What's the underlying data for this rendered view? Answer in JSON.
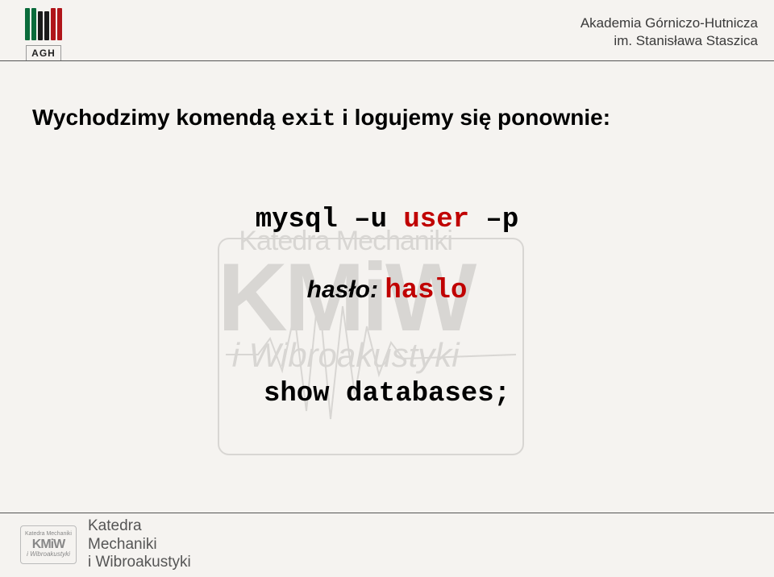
{
  "header": {
    "logo_abbr": "AGH",
    "university_line1": "Akademia Górniczo-Hutnicza",
    "university_line2": "im. Stanisława Staszica"
  },
  "content": {
    "intro_part1": "Wychodzimy komendą ",
    "intro_cmd": "exit",
    "intro_part2": " i logujemy się ponownie:",
    "mysql_cmd_prefix": "mysql –u ",
    "mysql_cmd_user": "user",
    "mysql_cmd_suffix": " –p",
    "password_label": "hasło: ",
    "password_value": "haslo",
    "show_cmd": "show databases;"
  },
  "watermark": {
    "line1": "Katedra Mechaniki",
    "line2": "KMiW",
    "line3": "i Wibroakustyki"
  },
  "footer": {
    "logo_small_top": "Katedra Mechaniki",
    "logo_small_main": "KMiW",
    "logo_small_bottom": "i Wibroakustyki",
    "dept_line1": "Katedra",
    "dept_line2": "Mechaniki",
    "dept_line3": "i Wibroakustyki"
  }
}
